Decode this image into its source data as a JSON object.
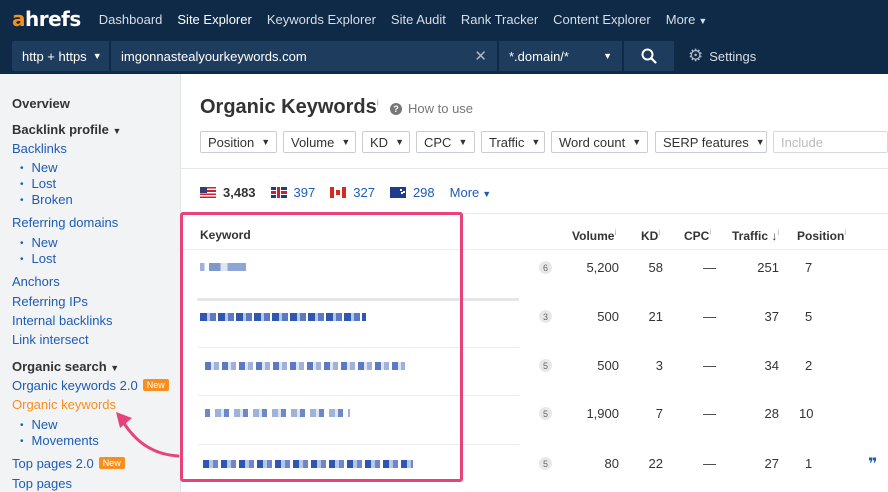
{
  "app": {
    "logo_a": "a",
    "logo_rest": "hrefs"
  },
  "nav": {
    "items": [
      {
        "label": "Dashboard"
      },
      {
        "label": "Site Explorer"
      },
      {
        "label": "Keywords Explorer"
      },
      {
        "label": "Site Audit"
      },
      {
        "label": "Rank Tracker"
      },
      {
        "label": "Content Explorer"
      },
      {
        "label": "More"
      }
    ]
  },
  "search": {
    "protocol": "http + https",
    "url": "imgonnastealyourkeywords.com",
    "mode": "*.domain/*",
    "settings_label": "Settings"
  },
  "sidebar": {
    "overview": "Overview",
    "backlink_profile": "Backlink profile",
    "backlinks": "Backlinks",
    "backlinks_new": "New",
    "backlinks_lost": "Lost",
    "backlinks_broken": "Broken",
    "referring_domains": "Referring domains",
    "rd_new": "New",
    "rd_lost": "Lost",
    "anchors": "Anchors",
    "referring_ips": "Referring IPs",
    "internal_backlinks": "Internal backlinks",
    "link_intersect": "Link intersect",
    "organic_search": "Organic search",
    "organic_keywords_2": "Organic keywords 2.0",
    "new_badge": "New",
    "organic_keywords": "Organic keywords",
    "ok_new": "New",
    "ok_movements": "Movements",
    "top_pages_2": "Top pages 2.0",
    "top_pages": "Top pages"
  },
  "page": {
    "title": "Organic Keywords",
    "title_info": "i",
    "how_to_use": "How to use"
  },
  "filters": {
    "position": "Position",
    "volume": "Volume",
    "kd": "KD",
    "cpc": "CPC",
    "traffic": "Traffic",
    "word_count": "Word count",
    "serp_features": "SERP features",
    "include_placeholder": "Include"
  },
  "countries": [
    {
      "code": "us",
      "count": "3,483"
    },
    {
      "code": "gb",
      "count": "397"
    },
    {
      "code": "ca",
      "count": "327"
    },
    {
      "code": "au",
      "count": "298"
    }
  ],
  "countries_more": "More",
  "table": {
    "headers": {
      "keyword": "Keyword",
      "volume": "Volume",
      "kd": "KD",
      "cpc": "CPC",
      "traffic": "Traffic",
      "position": "Position",
      "info": "i",
      "sort_arrow": "↓"
    },
    "rows": [
      {
        "serp": "6",
        "volume": "5,200",
        "kd": "58",
        "cpc": "—",
        "traffic": "251",
        "position": "7"
      },
      {
        "serp": "3",
        "volume": "500",
        "kd": "21",
        "cpc": "—",
        "traffic": "37",
        "position": "5"
      },
      {
        "serp": "5",
        "volume": "500",
        "kd": "3",
        "cpc": "—",
        "traffic": "34",
        "position": "2"
      },
      {
        "serp": "5",
        "volume": "1,900",
        "kd": "7",
        "cpc": "—",
        "traffic": "28",
        "position": "10"
      },
      {
        "serp": "5",
        "volume": "80",
        "kd": "22",
        "cpc": "—",
        "traffic": "27",
        "position": "1"
      }
    ]
  },
  "colors": {
    "nav_bg": "#0e2a47",
    "accent_orange": "#f78f1e",
    "link_blue": "#1d5bb5",
    "highlight_pink": "#e8427a"
  }
}
